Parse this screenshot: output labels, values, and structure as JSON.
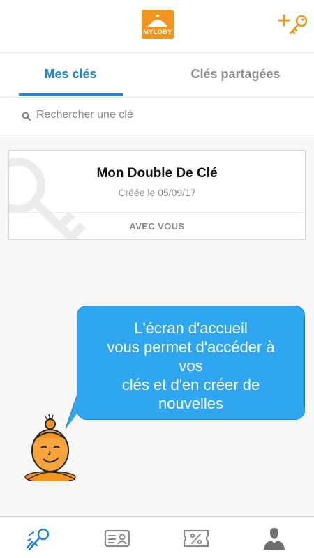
{
  "header": {
    "logo_text": "MYLOBY",
    "logo_icon": "hotel-bell-logo",
    "add_key_icon": "add-key-icon"
  },
  "tabs": [
    {
      "label": "Mes clés",
      "active": true
    },
    {
      "label": "Clés partagées",
      "active": false
    }
  ],
  "search": {
    "placeholder": "Rechercher une clé",
    "icon": "search-icon"
  },
  "keys": [
    {
      "title": "Mon Double De Clé",
      "created": "Créée le 05/09/17",
      "status": "AVEC VOUS"
    }
  ],
  "tooltip": {
    "lines": [
      "L'écran d'accueil",
      "vous permet d'accéder à",
      "vos",
      "clés et d'en créer de",
      "nouvelles"
    ]
  },
  "bottom_nav": [
    {
      "icon": "keys-icon",
      "active": true
    },
    {
      "icon": "id-card-icon",
      "active": false
    },
    {
      "icon": "discount-ticket-icon",
      "active": false
    },
    {
      "icon": "profile-icon",
      "active": false
    }
  ],
  "colors": {
    "accent": "#1a86d9",
    "brand_orange": "#f2941d",
    "tooltip_blue": "#2ea6f1"
  }
}
